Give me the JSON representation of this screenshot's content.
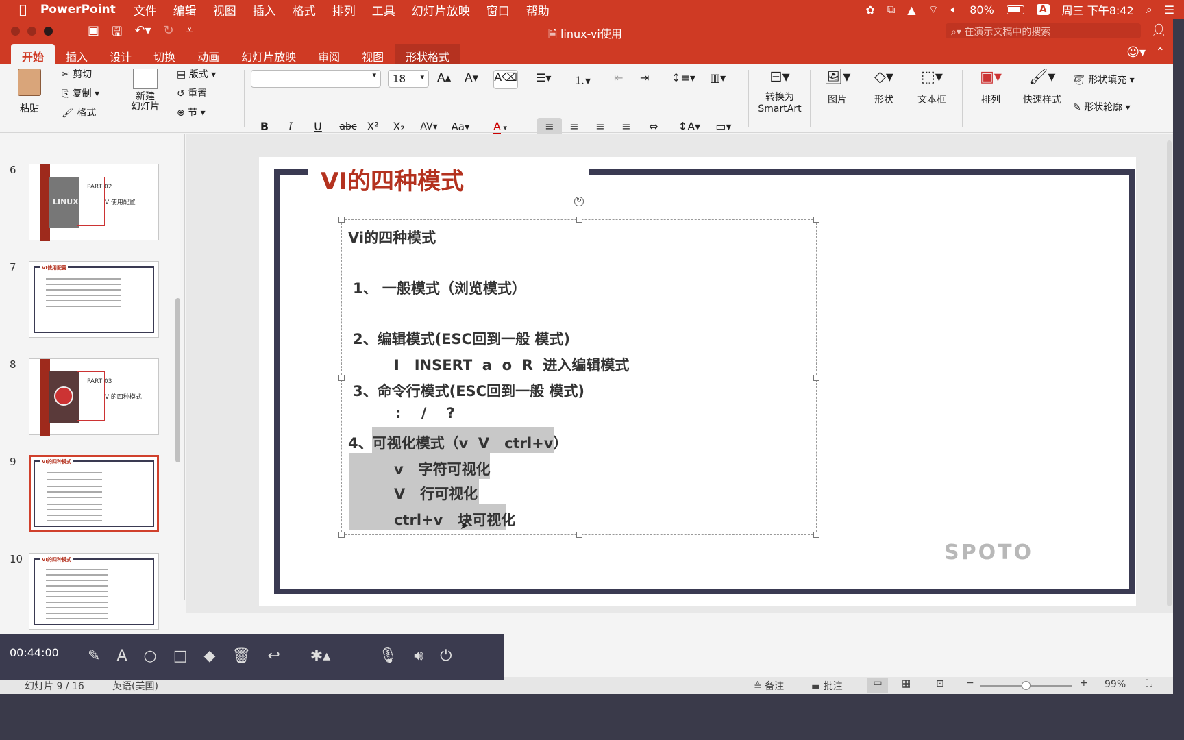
{
  "menubar": {
    "app_name": "PowerPoint",
    "items": [
      "文件",
      "编辑",
      "视图",
      "插入",
      "格式",
      "排列",
      "工具",
      "幻灯片放映",
      "窗口",
      "帮助"
    ],
    "battery": "80%",
    "clock": "周三 下午8:42",
    "input_method": "A"
  },
  "window": {
    "title": "linux-vi使用",
    "search_placeholder": "在演示文稿中的搜索"
  },
  "tabs": [
    "开始",
    "插入",
    "设计",
    "切换",
    "动画",
    "幻灯片放映",
    "审阅",
    "视图",
    "形状格式"
  ],
  "ribbon": {
    "paste": "粘贴",
    "cut": "剪切",
    "copy": "复制",
    "format": "格式",
    "new_slide": "新建\n幻灯片",
    "layout": "版式",
    "reset": "重置",
    "section": "节",
    "font_size": "18",
    "convert_smartart_1": "转换为",
    "convert_smartart_2": "SmartArt",
    "picture": "图片",
    "shape": "形状",
    "textbox": "文本框",
    "arrange": "排列",
    "quick_styles": "快速样式",
    "shape_fill": "形状填充",
    "shape_outline": "形状轮廓"
  },
  "thumbnails": [
    {
      "num": "6",
      "part": "PART 02",
      "title": "VI使用配置",
      "logo": "LINUX"
    },
    {
      "num": "7",
      "title": "VI使用配置"
    },
    {
      "num": "8",
      "part": "PART 03",
      "title": "VI的四种模式"
    },
    {
      "num": "9",
      "title": "VI的四种模式"
    },
    {
      "num": "10",
      "title": "VI的四种模式"
    }
  ],
  "slide": {
    "title": "VI的四种模式",
    "watermark": "SPOTO",
    "lines": [
      "Vi的四种模式",
      "1、 一般模式（浏览模式）",
      "2、编辑模式(ESC回到一般 模式)",
      "I   INSERT  a  o  R  进入编辑模式",
      "3、命令行模式(ESC回到一般 模式)",
      ":    /    ?",
      "4、可视化模式（v  V   ctrl+v）",
      "v   字符可视化",
      "V   行可视化",
      "ctrl+v   块可视化"
    ]
  },
  "statusbar": {
    "slide_info": "幻灯片 9 / 16",
    "language": "英语(美国)",
    "notes": "备注",
    "comments": "批注",
    "zoom": "99%",
    "zoom_fraction": 0.5
  },
  "recorder": {
    "time": "00:44:00"
  },
  "colors": {
    "accent": "#cf3a24",
    "slide_title": "#b4321f",
    "frame": "#3a3a52"
  }
}
